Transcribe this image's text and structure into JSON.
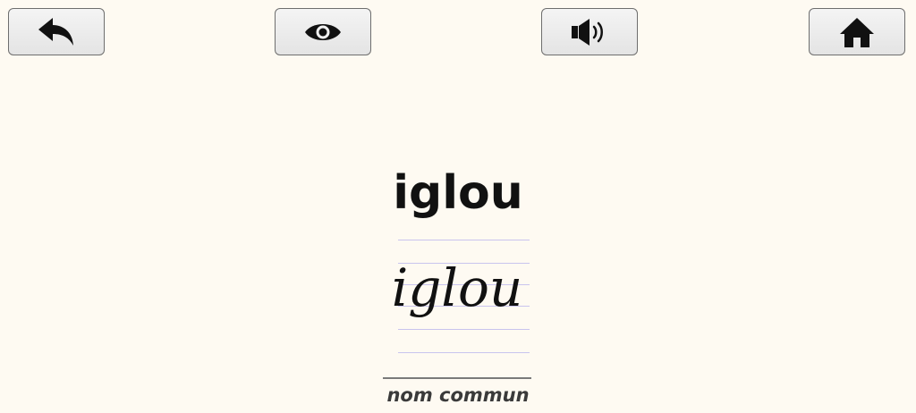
{
  "toolbar": {
    "back_icon": "back-arrow-icon",
    "eye_icon": "eye-icon",
    "sound_icon": "speaker-icon",
    "home_icon": "home-icon"
  },
  "word": {
    "print": "iglou",
    "cursive": "iglou",
    "category": "nom commun"
  },
  "colors": {
    "background": "#fefaf2",
    "guide_lines": "#c9c4ee"
  }
}
